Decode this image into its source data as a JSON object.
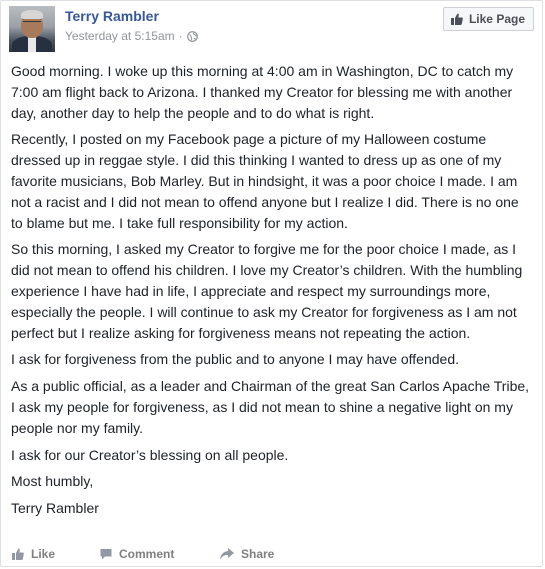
{
  "post": {
    "author": "Terry Rambler",
    "timestamp": "Yesterday at 5:15am",
    "separator": "·",
    "privacy_icon": "globe-icon",
    "like_page_label": "Like Page",
    "paragraphs": [
      "Good morning. I woke up this morning at 4:00 am in Washington, DC to catch my 7:00 am flight back to Arizona. I thanked my Creator for blessing me with another day, another day to help the people and to do what is right.",
      "Recently, I posted on my Facebook page a picture of my Halloween costume dressed up in reggae style. I did this thinking I wanted to dress up as one of my favorite musicians, Bob Marley. But in hindsight, it was a poor choice I made. I am not a racist and I did not mean to offend anyone but I realize I did. There is no one to blame but me. I take full responsibility for my action.",
      "So this morning, I asked my Creator to forgive me for the poor choice I made, as I did not mean to offend his children. I love my Creator’s children. With the humbling experience I have had in life, I appreciate and respect my surroundings more, especially the people. I will continue to ask my Creator for forgiveness as I am not perfect but I realize asking for forgiveness means not repeating the action.",
      "I ask for forgiveness from the public and to anyone I may have offended.",
      "As a public official, as a leader and Chairman of the great San Carlos Apache Tribe, I ask my people for forgiveness, as I did not mean to shine a negative light on my people nor my family.",
      "I ask for our Creator’s blessing on all people.",
      "Most humbly,",
      "Terry Rambler"
    ]
  },
  "actions": {
    "like_label": "Like",
    "comment_label": "Comment",
    "share_label": "Share"
  },
  "colors": {
    "author_link": "#365899",
    "meta_text": "#90949c",
    "body_text": "#1d2129",
    "action_text": "#7f7f7f",
    "border": "#dddfe2"
  }
}
